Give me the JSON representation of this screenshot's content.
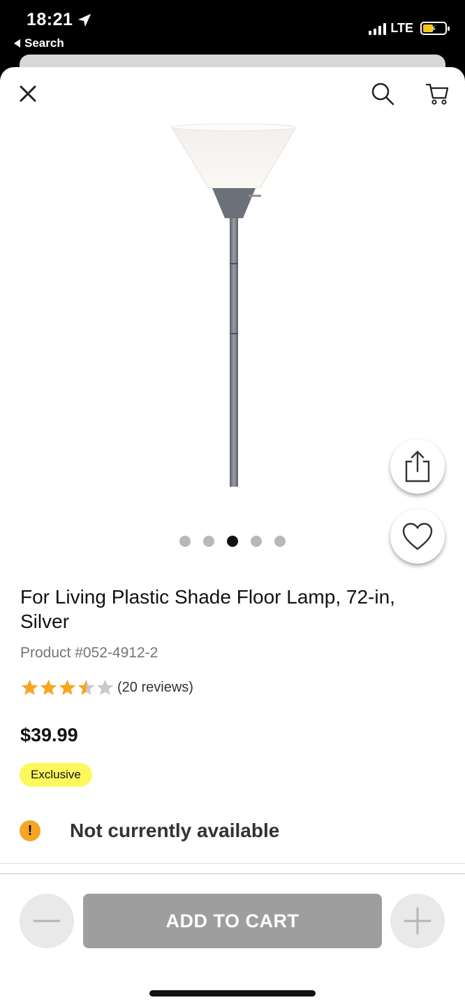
{
  "status_bar": {
    "time": "18:21",
    "back_label": "Search",
    "network": "LTE"
  },
  "header": {
    "close_icon": "close-icon",
    "search_icon": "search-icon",
    "cart_icon": "cart-icon"
  },
  "gallery": {
    "image_count": 5,
    "active_index": 2
  },
  "product": {
    "title": "For Living Plastic Shade Floor Lamp, 72-in, Silver",
    "product_number": "Product #052-4912-2",
    "rating": 3.5,
    "rating_max": 5,
    "reviews_text": "(20 reviews)",
    "price": "$39.99",
    "badge": "Exclusive",
    "availability": "Not currently available"
  },
  "actions": {
    "add_to_cart": "ADD TO CART"
  },
  "colors": {
    "star": "#f5a623",
    "badge_bg": "#fbf95b",
    "warning": "#f5a623",
    "disabled_button": "#9e9e9e"
  }
}
